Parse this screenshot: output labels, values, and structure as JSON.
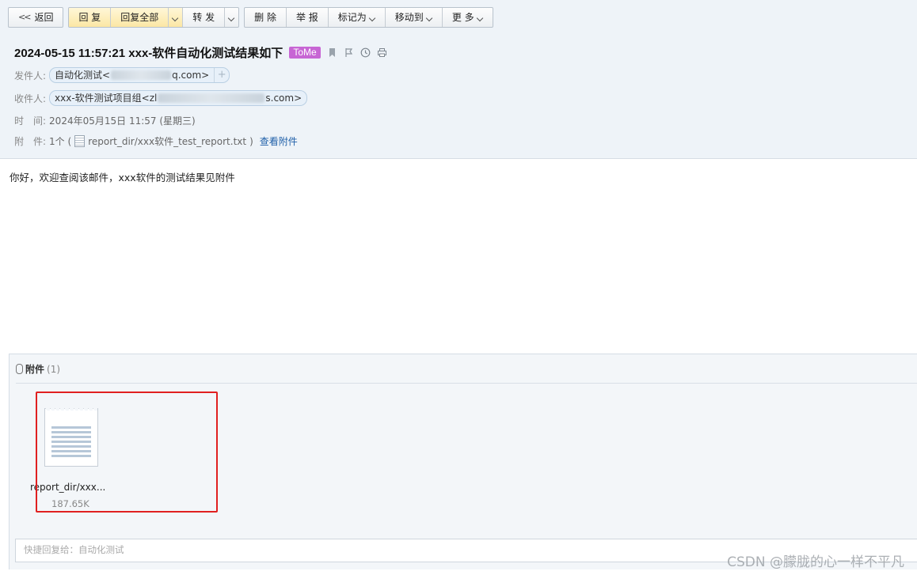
{
  "toolbar": {
    "back": "返回",
    "reply": "回 复",
    "reply_all": "回复全部",
    "forward": "转 发",
    "delete": "删 除",
    "report": "举 报",
    "mark_as": "标记为",
    "move_to": "移动到",
    "more": "更 多"
  },
  "mail": {
    "subject": "2024-05-15 11:57:21 xxx-软件自动化测试结果如下",
    "tag": "ToMe",
    "from_label": "发件人:",
    "from_name": "自动化测试<",
    "from_domain": "q.com>",
    "to_label": "收件人:",
    "to_name": "xxx-软件测试项目组<zl",
    "to_domain": "s.com>",
    "time_label": "时　间:",
    "time_value": "2024年05月15日 11:57 (星期三)",
    "attach_label": "附　件:",
    "attach_count_text": "1个 (",
    "attach_filename": "report_dir/xxx软件_test_report.txt",
    "attach_close": ")",
    "view_attachment": "查看附件",
    "body_text": "你好，欢迎查阅该邮件，xxx软件的测试结果见附件"
  },
  "attachments": {
    "title": "附件",
    "count": "(1)",
    "items": [
      {
        "name": "report_dir/xxx...",
        "size": "187.65K"
      }
    ]
  },
  "quick_reply": {
    "placeholder": "快捷回复给：自动化测试"
  },
  "watermark": "CSDN @朦胧的心一样不平凡",
  "colors": {
    "tag_bg": "#c766d4",
    "link": "#1f5fa8",
    "highlight": "#e02020",
    "header_bg": "#eef3f8"
  }
}
